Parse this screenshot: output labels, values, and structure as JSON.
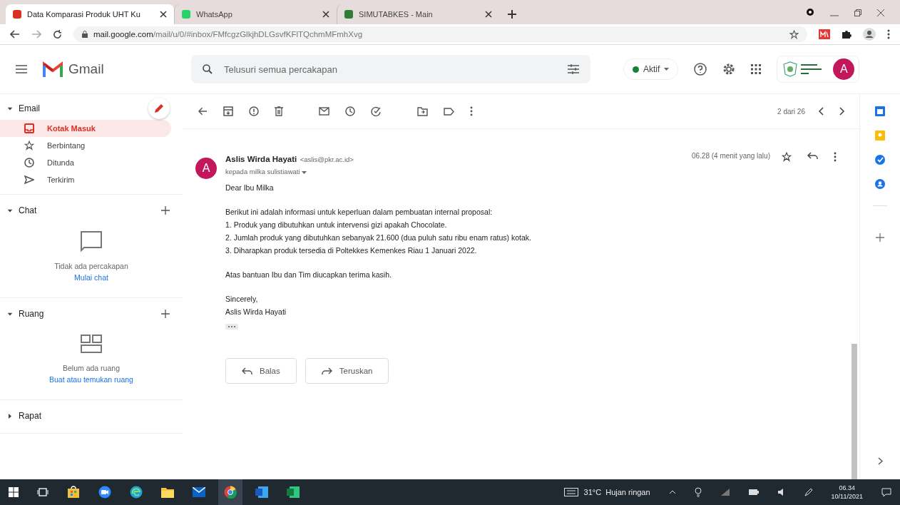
{
  "browser": {
    "tabs": [
      {
        "title": "Data Komparasi Produk UHT Ku",
        "selected": true
      },
      {
        "title": "WhatsApp",
        "selected": false
      },
      {
        "title": "SIMUTABKES - Main",
        "selected": false
      }
    ],
    "url_host": "mail.google.com",
    "url_path": "/mail/u/0/#inbox/FMfcgzGlkjhDLGsvfKFlTQchmMFmhXvg"
  },
  "header": {
    "app_name": "Gmail",
    "search": {
      "placeholder": "Telusuri semua percakapan"
    },
    "status": "Aktif",
    "avatar": "A"
  },
  "sidebar": {
    "sections": [
      {
        "title": "Email",
        "expanded": true,
        "items": [
          {
            "label": "Kotak Masuk",
            "selected": true
          },
          {
            "label": "Berbintang",
            "selected": false
          },
          {
            "label": "Ditunda",
            "selected": false
          },
          {
            "label": "Terkirim",
            "selected": false
          }
        ]
      },
      {
        "title": "Chat",
        "expanded": true,
        "empty_text": "Tidak ada percakapan",
        "link": "Mulai chat"
      },
      {
        "title": "Ruang",
        "expanded": true,
        "empty_text": "Belum ada ruang",
        "link": "Buat atau temukan ruang"
      },
      {
        "title": "Rapat",
        "expanded": false
      }
    ]
  },
  "toolbar": {
    "pager": "2 dari 26"
  },
  "message": {
    "avatar": "A",
    "sender": "Aslis Wirda Hayati",
    "email": "<aslis@pkr.ac.id>",
    "recipient": "kepada milka sulistiawati",
    "time": "06.28 (4 menit yang lalu)",
    "body": [
      [
        "Dear Ibu Milka"
      ],
      [
        "Berikut ini adalah informasi untuk keperluan dalam pembuatan internal proposal:",
        "1. Produk yang dibutuhkan untuk intervensi gizi apakah Chocolate.",
        "2. Jumlah produk yang dibutuhkan sebanyak 21.600 (dua puluh satu ribu enam ratus) kotak.",
        "3. Diharapkan produk tersedia di Poltekkes Kemenkes Riau 1 Januari 2022."
      ],
      [
        "Atas bantuan Ibu dan Tim diucapkan terima kasih."
      ],
      [
        "Sincerely,",
        "Aslis Wirda Hayati"
      ]
    ],
    "actions": [
      "Balas",
      "Teruskan"
    ]
  },
  "taskbar": {
    "weather": "31°C  Hujan ringan",
    "time": "06.34",
    "date": "10/11/2021"
  }
}
